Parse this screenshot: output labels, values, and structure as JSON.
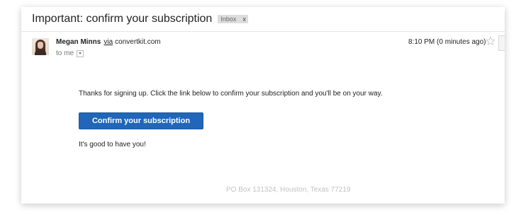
{
  "email": {
    "subject": "Important: confirm your subscription",
    "label": {
      "text": "Inbox",
      "close": "x"
    },
    "sender": {
      "name": "Megan Minns",
      "via": "via",
      "domain": "convertkit.com"
    },
    "recipient": "to me",
    "time": "8:10 PM (0 minutes ago)",
    "icons": {
      "avatar": "avatar-photo",
      "star": "star-icon",
      "details": "chevron-down-icon"
    }
  },
  "message": {
    "intro": "Thanks for signing up. Click the link below to confirm your subscription and you'll be on your way.",
    "button_label": "Confirm your subscription",
    "closing": "It's good to have you!",
    "footer_address": "PO Box 131324, Houston, Texas 77219"
  },
  "colors": {
    "button_bg": "#2166b8",
    "label_bg": "#dddddd",
    "footer_text": "#c2c2c2"
  }
}
